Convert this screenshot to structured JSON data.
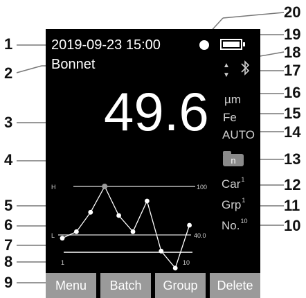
{
  "status": {
    "datetime": "2019-09-23 15:00",
    "mode": "Bonnet"
  },
  "reading": {
    "value": "49.6",
    "unit": "µm",
    "substrate": "Fe",
    "probe_mode": "AUTO"
  },
  "indicators": {
    "memory_label": "n"
  },
  "stats": {
    "car": {
      "label": "Car",
      "value": "1"
    },
    "grp": {
      "label": "Grp",
      "value": "1"
    },
    "no": {
      "label": "No.",
      "value": "10"
    }
  },
  "chart_data": {
    "type": "line",
    "x": [
      1,
      2,
      3,
      4,
      5,
      6,
      7,
      8,
      9,
      10
    ],
    "values": [
      36,
      44,
      68,
      100,
      64,
      44,
      82,
      20,
      -1,
      52
    ],
    "h_label": "H",
    "h_value": "100",
    "l_label": "L",
    "l_value": "40.0",
    "x_start_label": "1",
    "x_end_label": "10",
    "highlight_index": 3
  },
  "buttons": [
    "Menu",
    "Batch",
    "Group",
    "Delete"
  ],
  "callouts": [
    "1",
    "2",
    "3",
    "4",
    "5",
    "6",
    "7",
    "8",
    "9",
    "10",
    "11",
    "12",
    "13",
    "14",
    "15",
    "16",
    "17",
    "18",
    "19",
    "20"
  ],
  "colors": {
    "screen_bg": "#000000",
    "button_bg": "#9a9a9a",
    "text": "#ffffff",
    "secondary_text": "#cfcfcf"
  }
}
